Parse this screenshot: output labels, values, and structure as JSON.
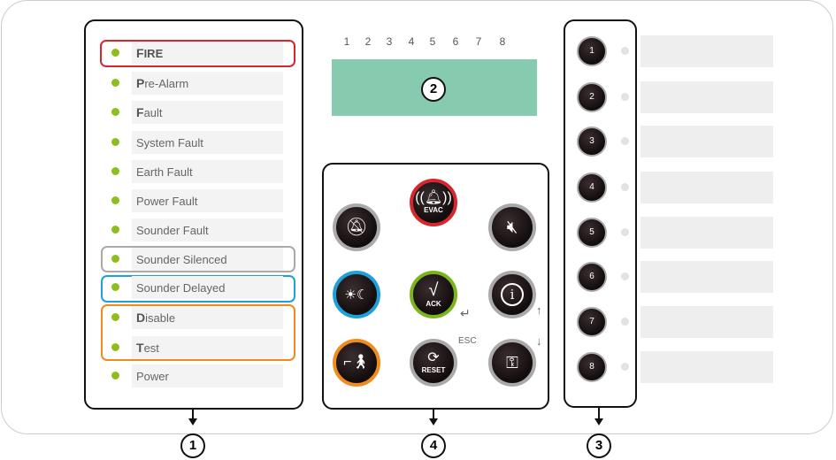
{
  "indicators": [
    {
      "first": "F",
      "rest": "IRE",
      "bold": true
    },
    {
      "first": "P",
      "rest": "re-Alarm",
      "bold": true
    },
    {
      "first": "F",
      "rest": "ault",
      "bold": true
    },
    {
      "first": "",
      "rest": "System Fault"
    },
    {
      "first": "",
      "rest": "Earth Fault"
    },
    {
      "first": "",
      "rest": "Power Fault"
    },
    {
      "first": "",
      "rest": "Sounder Fault"
    },
    {
      "first": "",
      "rest": "Sounder Silenced"
    },
    {
      "first": "",
      "rest": "Sounder Delayed"
    },
    {
      "first": "D",
      "rest": "isable",
      "bold": true
    },
    {
      "first": "T",
      "rest": "est",
      "bold": true
    },
    {
      "first": "",
      "rest": "Power"
    }
  ],
  "led_color": "#8cbf1e",
  "display": {
    "digits": [
      "1",
      "2",
      "3",
      "4",
      "5",
      "6",
      "7",
      "8"
    ],
    "color": "#86cbb0"
  },
  "buttons": {
    "evac": "EVAC",
    "ack": "ACK",
    "reset": "RESET",
    "esc": "ESC"
  },
  "zones": [
    "1",
    "2",
    "3",
    "4",
    "5",
    "6",
    "7",
    "8"
  ],
  "callouts": {
    "left": "1",
    "display": "2",
    "zones": "3",
    "keypad": "4"
  }
}
